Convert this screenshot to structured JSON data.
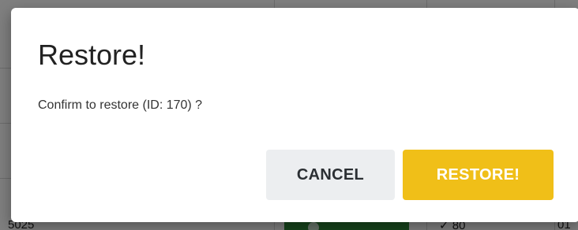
{
  "dialog": {
    "title": "Restore!",
    "message": "Confirm to restore (ID: 170) ?",
    "cancel_label": "CANCEL",
    "confirm_label": "RESTORE!"
  },
  "background": {
    "partial_text_left": "5025",
    "partial_text_right": "✓ 80",
    "partial_text_edge": "01"
  },
  "colors": {
    "confirm_button": "#f0bf18",
    "cancel_button": "#eceef0",
    "overlay": "rgba(0,0,0,0.5)",
    "background_green": "#2e8b3a"
  }
}
